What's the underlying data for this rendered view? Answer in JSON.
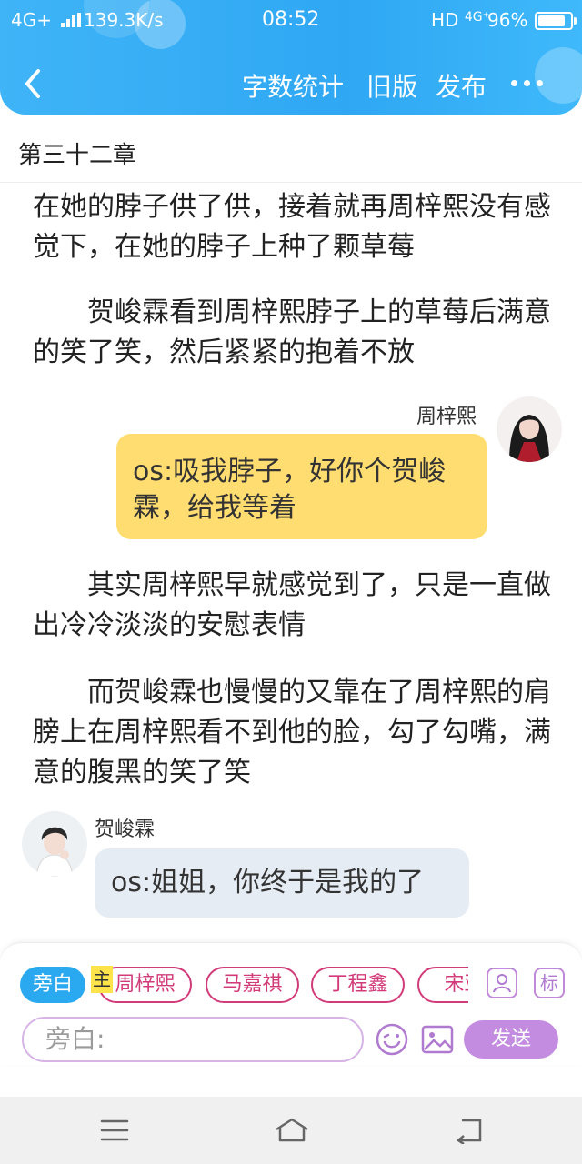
{
  "status_bar": {
    "network": "4G+",
    "speed": "139.3K/s",
    "time": "08:52",
    "hd": "HD",
    "net2": "4G⁺",
    "battery": "96%",
    "battery_level": 0.96
  },
  "header": {
    "actions": [
      "字数统计",
      "旧版",
      "发布"
    ],
    "accent": "#2fa7f3"
  },
  "chapter_title": "第三十二章",
  "story": {
    "para1": "在她的脖子供了供，接着就再周梓熙没有感觉下，在她的脖子上种了颗草莓",
    "para2": "　　贺峻霖看到周梓熙脖子上的草莓后满意的笑了笑，然后紧紧的抱着不放",
    "msg1": {
      "name": "周梓熙",
      "text": "os:吸我脖子，好你个贺峻霖，给我等着"
    },
    "para3": "　　其实周梓熙早就感觉到了，只是一直做出冷冷淡淡的安慰表情",
    "para4": "　　而贺峻霖也慢慢的又靠在了周梓熙的肩膀上在周梓熙看不到他的脸，勾了勾嘴，满意的腹黑的笑了笑",
    "msg2": {
      "name": "贺峻霖",
      "text": "os:姐姐，你终于是我的了"
    }
  },
  "composer": {
    "active_chip": "旁白",
    "main_badge": "主",
    "characters": [
      "周梓熙",
      "马嘉祺",
      "丁程鑫",
      "宋亚"
    ],
    "tag_button": "标",
    "placeholder": "旁白:",
    "send_label": "发送",
    "accent_pink": "#d23b7a",
    "accent_purple": "#c48ce0"
  }
}
